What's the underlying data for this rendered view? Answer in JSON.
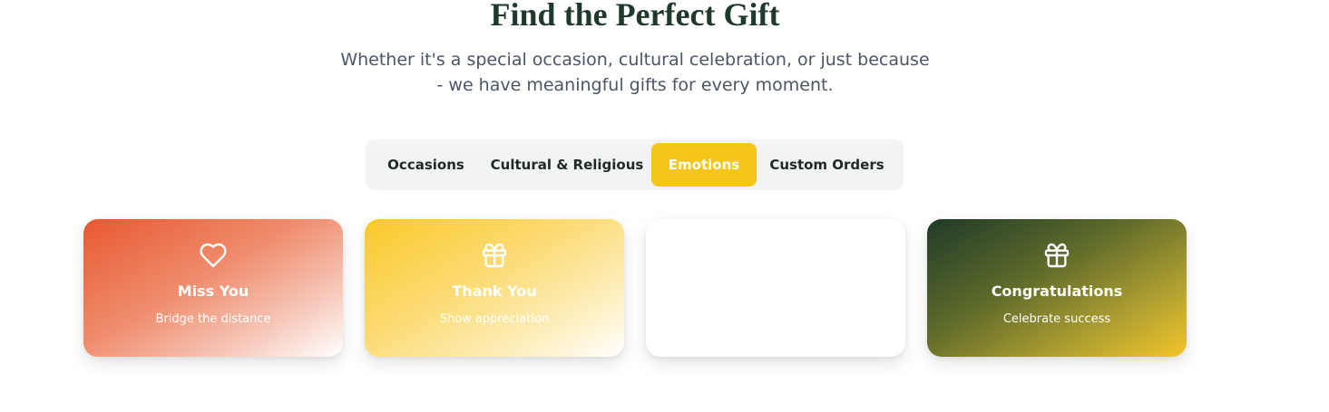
{
  "header": {
    "title": "Find the Perfect Gift",
    "subtitle": "Whether it's a special occasion, cultural celebration, or just because - we have meaningful gifts for every moment."
  },
  "tabs": [
    {
      "label": "Occasions",
      "active": false
    },
    {
      "label": "Cultural & Religious",
      "active": false
    },
    {
      "label": "Emotions",
      "active": true
    },
    {
      "label": "Custom Orders",
      "active": false
    }
  ],
  "cards": [
    {
      "title": "Miss You",
      "subtitle": "Bridge the distance",
      "icon": "heart-icon"
    },
    {
      "title": "Thank You",
      "subtitle": "Show appreciation",
      "icon": "gift-icon"
    },
    {
      "title": "",
      "subtitle": "",
      "icon": ""
    },
    {
      "title": "Congratulations",
      "subtitle": "Celebrate success",
      "icon": "gift-icon"
    }
  ],
  "colors": {
    "title": "#1f3a2c",
    "active_tab": "#f5c518",
    "tab_bar_bg": "#f2f3f5"
  }
}
